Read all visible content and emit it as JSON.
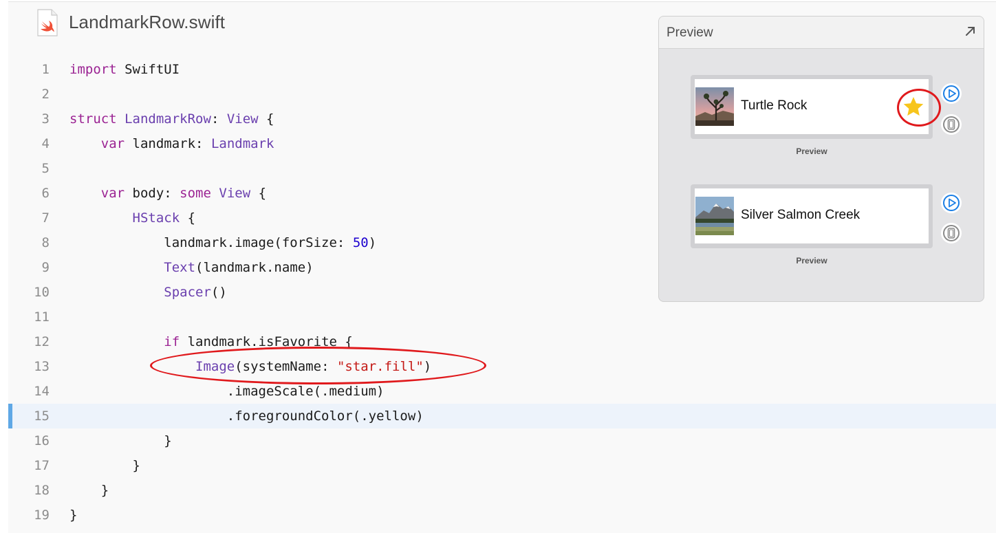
{
  "file": {
    "title": "LandmarkRow.swift",
    "icon": "swift-file-icon"
  },
  "code": {
    "highlighted_line": 15,
    "lines": [
      {
        "n": "1",
        "tokens": [
          {
            "t": "import",
            "c": "kw"
          },
          {
            "t": " SwiftUI",
            "c": ""
          }
        ]
      },
      {
        "n": "2",
        "tokens": []
      },
      {
        "n": "3",
        "tokens": [
          {
            "t": "struct",
            "c": "kw"
          },
          {
            "t": " ",
            "c": ""
          },
          {
            "t": "LandmarkRow",
            "c": "ty"
          },
          {
            "t": ": ",
            "c": ""
          },
          {
            "t": "View",
            "c": "ty"
          },
          {
            "t": " {",
            "c": ""
          }
        ]
      },
      {
        "n": "4",
        "tokens": [
          {
            "t": "    ",
            "c": ""
          },
          {
            "t": "var",
            "c": "kw"
          },
          {
            "t": " landmark: ",
            "c": ""
          },
          {
            "t": "Landmark",
            "c": "ty"
          }
        ]
      },
      {
        "n": "5",
        "tokens": []
      },
      {
        "n": "6",
        "tokens": [
          {
            "t": "    ",
            "c": ""
          },
          {
            "t": "var",
            "c": "kw"
          },
          {
            "t": " body: ",
            "c": ""
          },
          {
            "t": "some",
            "c": "kw"
          },
          {
            "t": " ",
            "c": ""
          },
          {
            "t": "View",
            "c": "ty"
          },
          {
            "t": " {",
            "c": ""
          }
        ]
      },
      {
        "n": "7",
        "tokens": [
          {
            "t": "        ",
            "c": ""
          },
          {
            "t": "HStack",
            "c": "fn"
          },
          {
            "t": " {",
            "c": ""
          }
        ]
      },
      {
        "n": "8",
        "tokens": [
          {
            "t": "            landmark.image(forSize: ",
            "c": ""
          },
          {
            "t": "50",
            "c": "num"
          },
          {
            "t": ")",
            "c": ""
          }
        ]
      },
      {
        "n": "9",
        "tokens": [
          {
            "t": "            ",
            "c": ""
          },
          {
            "t": "Text",
            "c": "fn"
          },
          {
            "t": "(landmark.name)",
            "c": ""
          }
        ]
      },
      {
        "n": "10",
        "tokens": [
          {
            "t": "            ",
            "c": ""
          },
          {
            "t": "Spacer",
            "c": "fn"
          },
          {
            "t": "()",
            "c": ""
          }
        ]
      },
      {
        "n": "11",
        "tokens": []
      },
      {
        "n": "12",
        "tokens": [
          {
            "t": "            ",
            "c": ""
          },
          {
            "t": "if",
            "c": "kw"
          },
          {
            "t": " landmark.isFavorite {",
            "c": ""
          }
        ]
      },
      {
        "n": "13",
        "tokens": [
          {
            "t": "                ",
            "c": ""
          },
          {
            "t": "Image",
            "c": "fn"
          },
          {
            "t": "(systemName: ",
            "c": ""
          },
          {
            "t": "\"star.fill\"",
            "c": "str"
          },
          {
            "t": ")",
            "c": ""
          }
        ]
      },
      {
        "n": "14",
        "tokens": [
          {
            "t": "                    .imageScale(.medium)",
            "c": ""
          }
        ]
      },
      {
        "n": "15",
        "tokens": [
          {
            "t": "                    .foregroundColor(.yellow)",
            "c": ""
          }
        ]
      },
      {
        "n": "16",
        "tokens": [
          {
            "t": "            }",
            "c": ""
          }
        ]
      },
      {
        "n": "17",
        "tokens": [
          {
            "t": "        }",
            "c": ""
          }
        ]
      },
      {
        "n": "18",
        "tokens": [
          {
            "t": "    }",
            "c": ""
          }
        ]
      },
      {
        "n": "19",
        "tokens": [
          {
            "t": "}",
            "c": ""
          }
        ]
      }
    ]
  },
  "preview": {
    "title": "Preview",
    "expand_icon": "arrow-up-right-icon",
    "rows": [
      {
        "label": "Turtle Rock",
        "favorite": true,
        "caption": "Preview",
        "thumb": "joshua-tree-photo"
      },
      {
        "label": "Silver Salmon Creek",
        "favorite": false,
        "caption": "Preview",
        "thumb": "mountain-lake-photo"
      }
    ],
    "buttons": [
      "live-preview-play-icon",
      "preview-on-device-icon"
    ]
  },
  "colors": {
    "keyword": "#9b2393",
    "type": "#6a3fae",
    "number": "#1c00cf",
    "string": "#c41a16",
    "highlight_bg": "#edf3fb",
    "highlight_bar": "#5fa8e6",
    "star": "#f7c51c",
    "annotation": "#e0191c",
    "button_blue": "#1a7ee5"
  }
}
